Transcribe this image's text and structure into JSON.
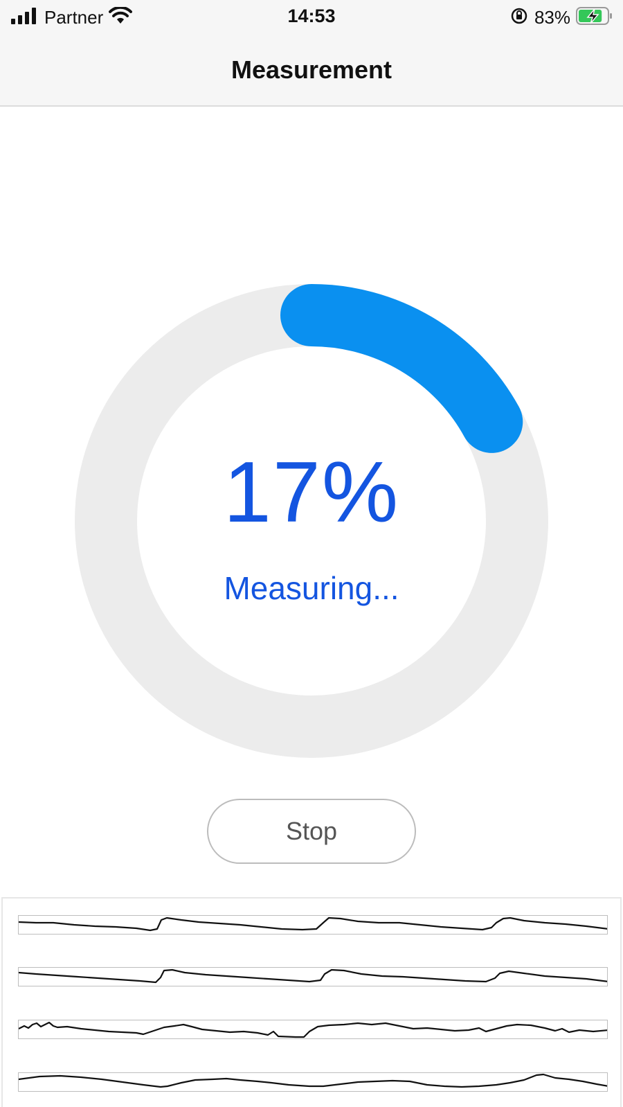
{
  "status_bar": {
    "carrier": "Partner",
    "time": "14:53",
    "battery_percent": "83%",
    "icons": [
      "signal-bars-icon",
      "wifi-icon",
      "orientation-lock-icon",
      "battery-charging-icon"
    ],
    "battery_color": "#34c759",
    "battery_level": 0.83
  },
  "nav": {
    "title": "Measurement"
  },
  "progress": {
    "value_text": "17%",
    "percent": 17,
    "status_text": "Measuring...",
    "ring_color": "#0a90f0",
    "track_color": "#ececec",
    "text_color": "#1455e0"
  },
  "stop_button": {
    "label": "Stop"
  },
  "waveforms": {
    "line_color": "#111111",
    "border_color": "#bdbdbd",
    "icons": [
      "waveform-channel-1",
      "waveform-channel-2",
      "waveform-channel-3",
      "waveform-channel-4"
    ]
  }
}
